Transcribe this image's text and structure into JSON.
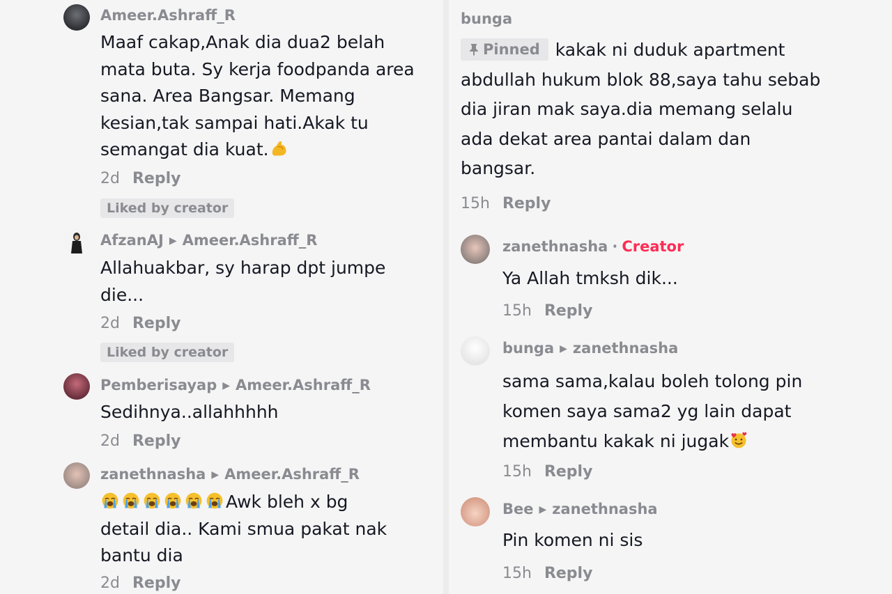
{
  "left": {
    "comments": [
      {
        "username": "Ameer.Ashraff_R",
        "lines": [
          "Maaf cakap,Anak dia dua2 belah",
          "mata buta. Sy kerja foodpanda area",
          "sana. Area Bangsar. Memang",
          "kesian,tak sampai hati.Akak tu",
          "semangat dia kuat."
        ],
        "emoji_after": "flexed-biceps",
        "time": "2d",
        "reply": "Reply",
        "liked": "Liked by creator"
      },
      {
        "username": "AfzanAJ",
        "reply_to": "Ameer.Ashraff_R",
        "lines": [
          "Allahuakbar, sy harap dpt jumpe",
          "die..."
        ],
        "time": "2d",
        "reply": "Reply",
        "liked": "Liked by creator"
      },
      {
        "username": "Pemberisayap",
        "reply_to": "Ameer.Ashraff_R",
        "lines": [
          "Sedihnya..allahhhhh"
        ],
        "time": "2d",
        "reply": "Reply"
      },
      {
        "username": "zanethnasha",
        "reply_to": "Ameer.Ashraff_R",
        "emoji_before": "loudly-crying-face",
        "emoji_count": 6,
        "lines": [
          "Awk bleh x bg",
          "detail dia.. Kami smua pakat nak",
          "bantu dia"
        ],
        "time": "2d",
        "reply": "Reply"
      }
    ]
  },
  "right": {
    "pinned_comment": {
      "username": "bunga",
      "pinned_label": "Pinned",
      "pin_icon": "pin-icon",
      "lines": [
        "kakak ni duduk apartment",
        "abdullah hukum blok 88,saya tahu sebab",
        "dia jiran mak saya.dia memang selalu",
        "ada dekat area pantai dalam dan",
        "bangsar."
      ],
      "time": "15h",
      "reply": "Reply"
    },
    "replies": [
      {
        "username": "zanethnasha",
        "separator": "·",
        "badge": "Creator",
        "lines": [
          "Ya Allah tmksh dik..."
        ],
        "time": "15h",
        "reply": "Reply"
      },
      {
        "username": "bunga",
        "reply_to": "zanethnasha",
        "lines": [
          "sama sama,kalau boleh tolong pin",
          "komen saya sama2 yg lain dapat",
          "membantu kakak ni jugak"
        ],
        "emoji_after": "smiling-face-with-hearts",
        "time": "15h",
        "reply": "Reply"
      },
      {
        "username": "Bee",
        "reply_to": "zanethnasha",
        "lines": [
          "Pin komen ni sis"
        ],
        "time": "15h",
        "reply": "Reply"
      }
    ]
  },
  "colors": {
    "accent": "#fe2c55",
    "secondary_text": "#8a8b91",
    "primary_text": "#161823"
  }
}
